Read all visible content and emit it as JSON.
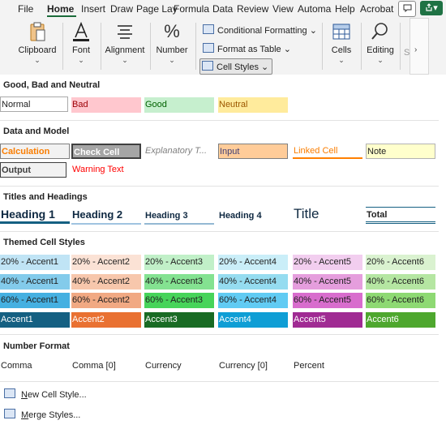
{
  "menu": {
    "tabs": [
      "File",
      "Home",
      "Insert",
      "Draw",
      "Page Lay",
      "Formula",
      "Data",
      "Review",
      "View",
      "Automa",
      "Help",
      "Acrobat"
    ],
    "active": "Home",
    "share_glyph": "▾"
  },
  "ribbon": {
    "clipboard": "Clipboard",
    "font": "Font",
    "alignment": "Alignment",
    "number": "Number",
    "conditional_formatting": "Conditional Formatting",
    "format_as_table": "Format as Table",
    "cell_styles": "Cell Styles",
    "cells": "Cells",
    "editing": "Editing",
    "clipped": "S",
    "percent_glyph": "%"
  },
  "gallery": {
    "sections": {
      "good_bad_neutral": "Good, Bad and Neutral",
      "data_model": "Data and Model",
      "titles_headings": "Titles and Headings",
      "themed": "Themed Cell Styles",
      "number_format": "Number Format"
    },
    "good_bad_neutral": [
      "Normal",
      "Bad",
      "Good",
      "Neutral"
    ],
    "data_model_row1": [
      "Calculation",
      "Check Cell",
      "Explanatory T...",
      "Input",
      "Linked Cell",
      "Note"
    ],
    "data_model_row2": [
      "Output",
      "Warning Text"
    ],
    "titles_headings": [
      "Heading 1",
      "Heading 2",
      "Heading 3",
      "Heading 4",
      "Title",
      "Total"
    ],
    "themed_20": [
      "20% - Accent1",
      "20% - Accent2",
      "20% - Accent3",
      "20% - Accent4",
      "20% - Accent5",
      "20% - Accent6"
    ],
    "themed_40": [
      "40% - Accent1",
      "40% - Accent2",
      "40% - Accent3",
      "40% - Accent4",
      "40% - Accent5",
      "40% - Accent6"
    ],
    "themed_60": [
      "60% - Accent1",
      "60% - Accent2",
      "60% - Accent3",
      "60% - Accent4",
      "60% - Accent5",
      "60% - Accent6"
    ],
    "themed_accent": [
      "Accent1",
      "Accent2",
      "Accent3",
      "Accent4",
      "Accent5",
      "Accent6"
    ],
    "number_format": [
      "Comma",
      "Comma [0]",
      "Currency",
      "Currency [0]",
      "Percent"
    ]
  },
  "footer": {
    "new_cell_style_u": "N",
    "new_cell_style": "ew Cell Style...",
    "merge_styles_u": "M",
    "merge_styles": "erge Styles..."
  },
  "colors": {
    "accent1": "#156082",
    "accent2": "#e97132",
    "accent3": "#196b24",
    "accent4": "#0f9ed5",
    "accent5": "#a02b93",
    "accent6": "#4ea72e",
    "excel_green": "#1f7244"
  }
}
